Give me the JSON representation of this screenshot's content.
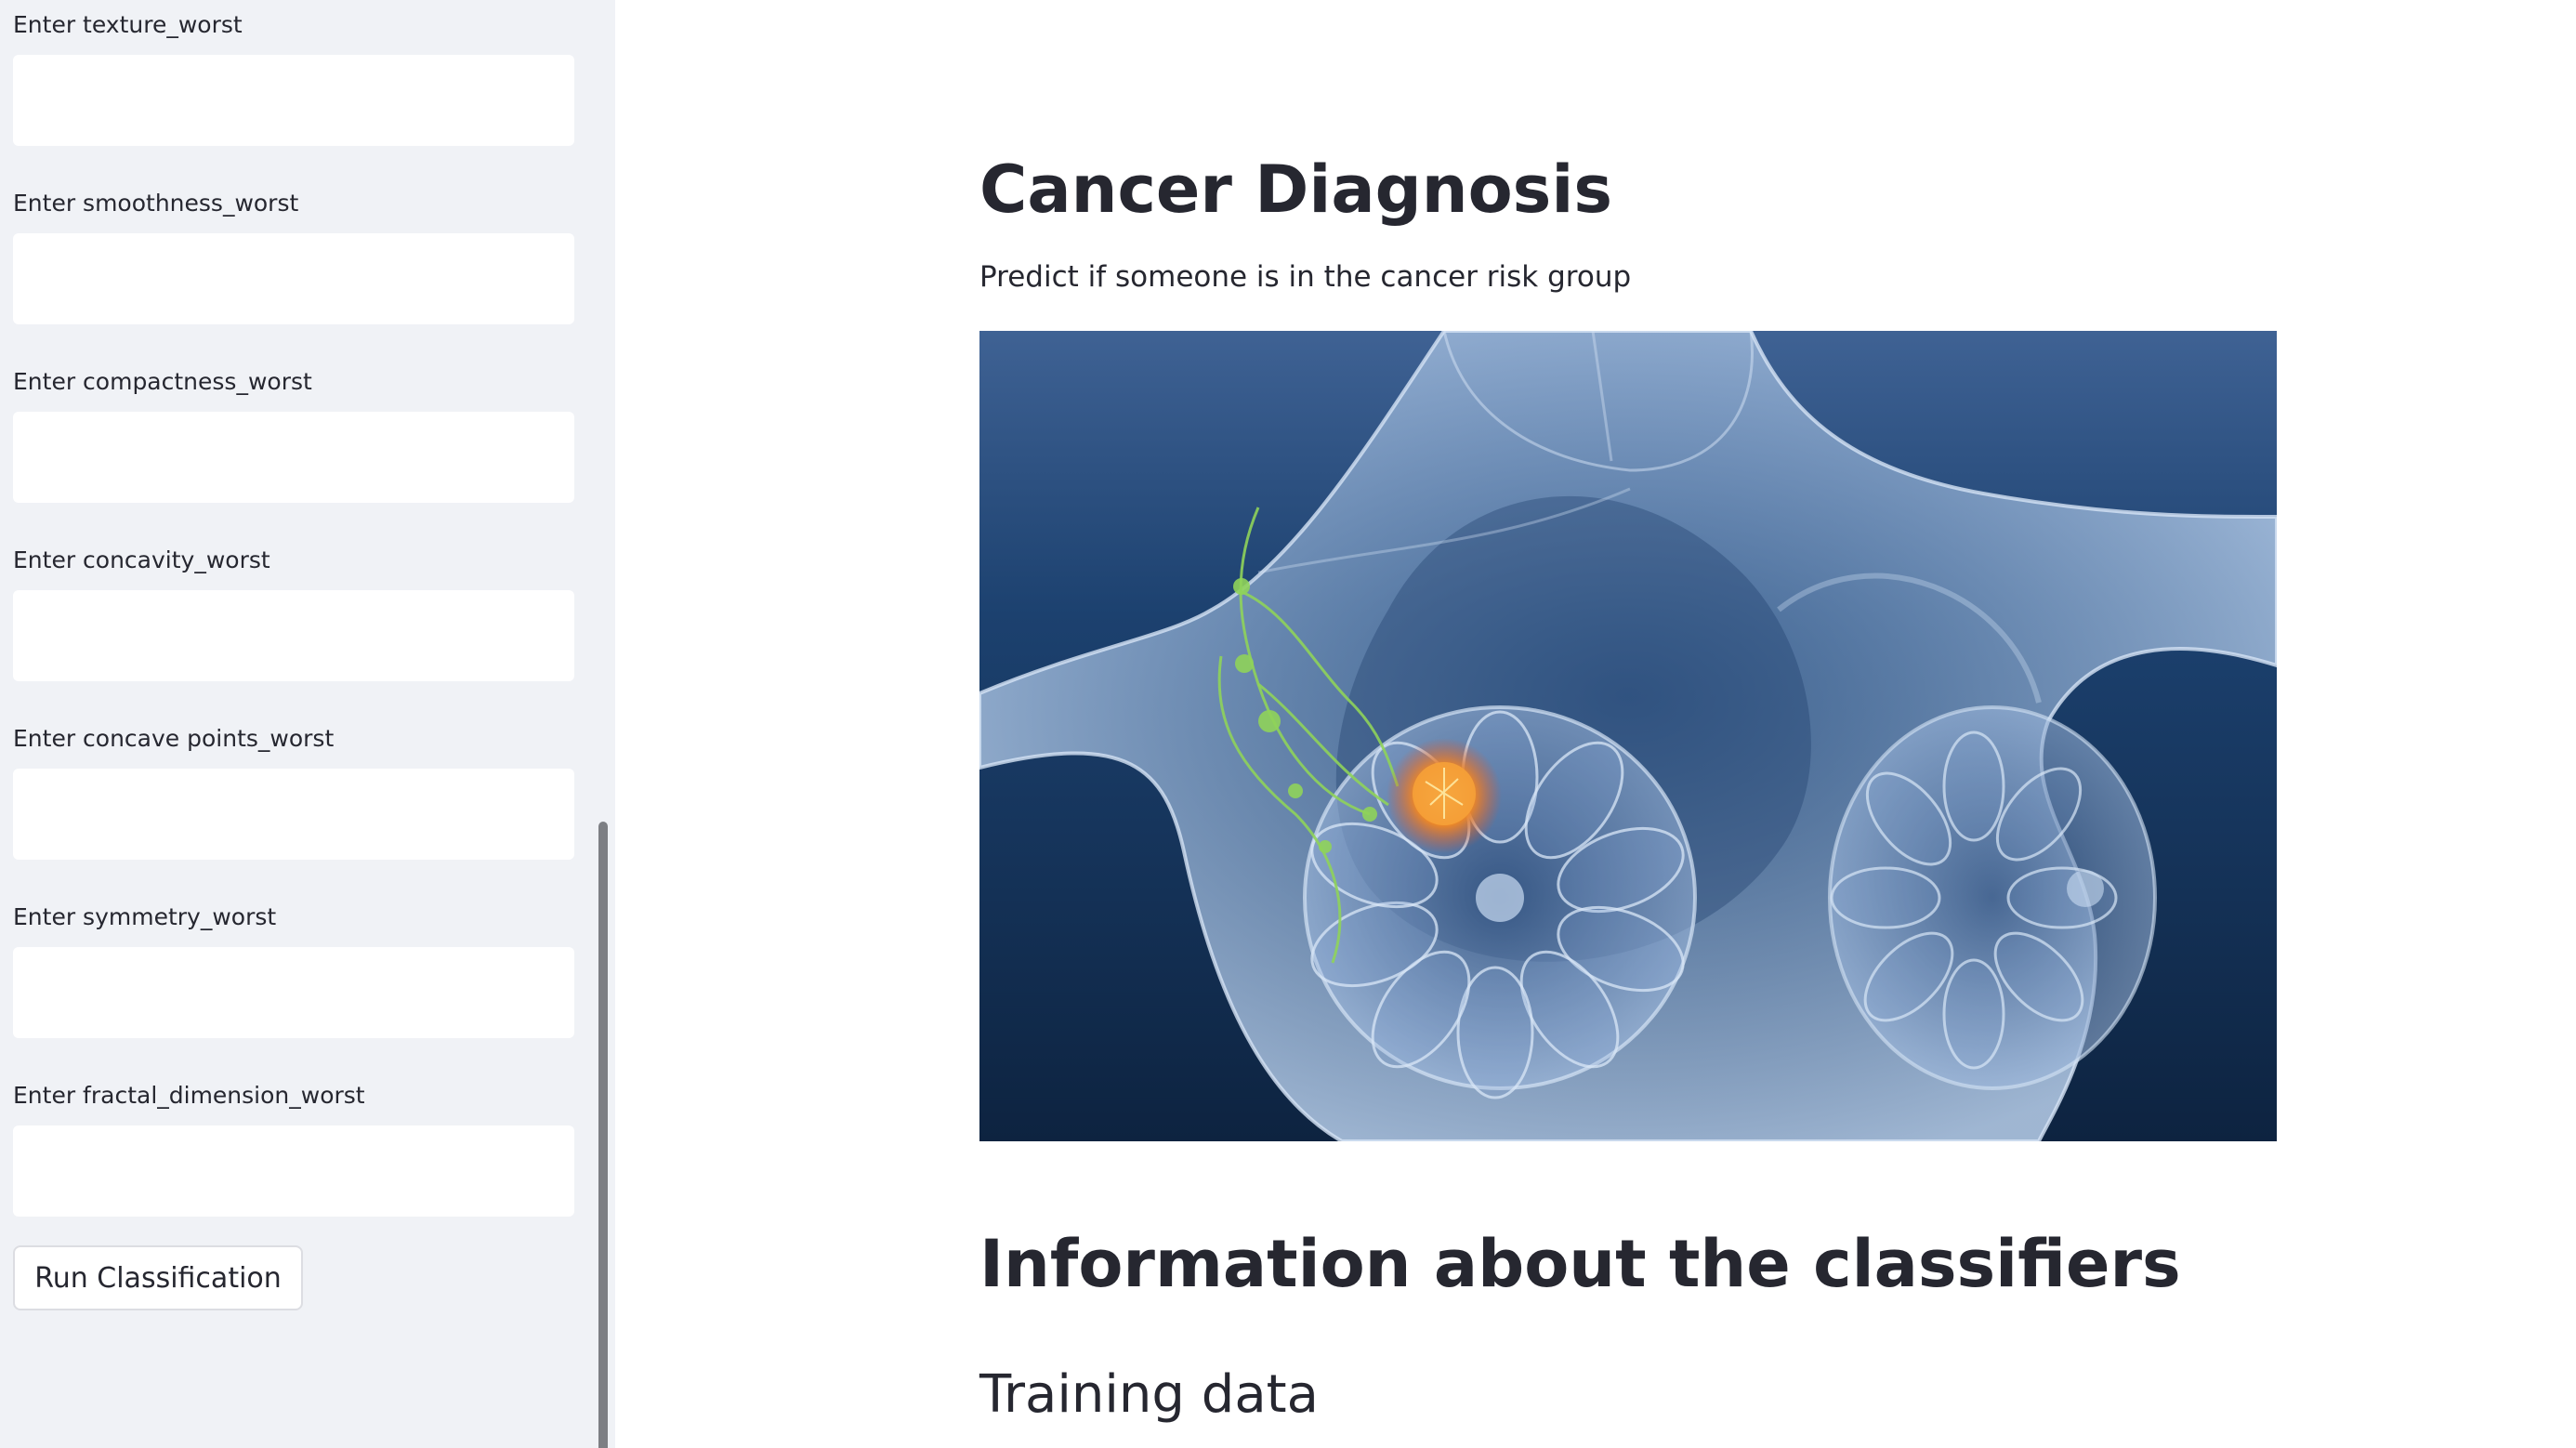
{
  "sidebar": {
    "fields": [
      {
        "label": "Enter texture_worst",
        "value": "",
        "placeholder": ""
      },
      {
        "label": "Enter smoothness_worst",
        "value": "",
        "placeholder": ""
      },
      {
        "label": "Enter compactness_worst",
        "value": "",
        "placeholder": ""
      },
      {
        "label": "Enter concavity_worst",
        "value": "",
        "placeholder": ""
      },
      {
        "label": "Enter concave points_worst",
        "value": "",
        "placeholder": ""
      },
      {
        "label": "Enter symmetry_worst",
        "value": "",
        "placeholder": ""
      },
      {
        "label": "Enter fractal_dimension_worst",
        "value": "",
        "placeholder": ""
      }
    ],
    "run_button_label": "Run Classification"
  },
  "main": {
    "title": "Cancer Diagnosis",
    "subtitle": "Predict if someone is in the cancer risk group",
    "hero_image": "breast-anatomy-illustration",
    "section_title": "Information about the classifiers",
    "subsection_title": "Training data"
  },
  "colors": {
    "sidebar_background": "#f0f2f6",
    "text": "#262730",
    "image_background": "#17375f",
    "tumor_highlight": "#f08a24",
    "lymph_nodes": "#8fd35a"
  }
}
